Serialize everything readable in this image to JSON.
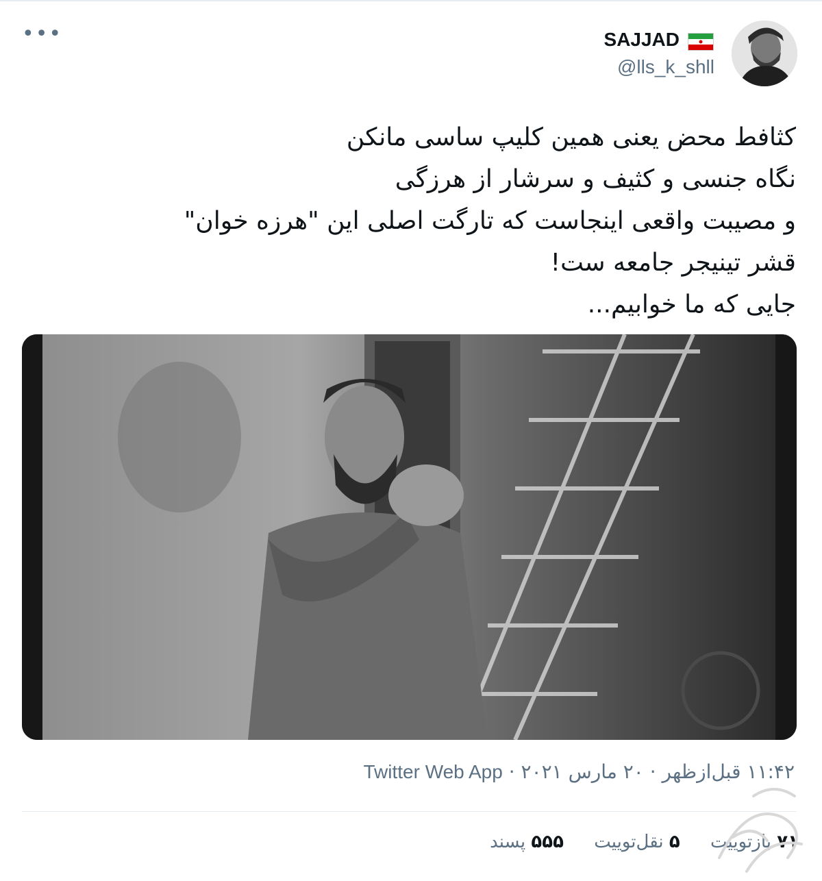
{
  "author": {
    "display_name": "SAJJAD",
    "handle": "@lls_k_shll",
    "flag": "iran-flag-icon"
  },
  "more_label": "•••",
  "tweet": {
    "lines": [
      "کثافط محض یعنی همین کلیپ ساسی مانکن",
      "نگاه جنسی و کثیف و سرشار از هرزگی",
      "و مصیبت واقعی اینجاست که تارگت اصلی این \"هرزه خوان\"",
      "قشر تینیجر جامعه ست!",
      "جایی که ما خوابیم..."
    ]
  },
  "media": {
    "type": "video-thumbnail",
    "description_icon": "video-frame"
  },
  "meta": {
    "time": "۱۱:۴۲ قبل‌ازظهر",
    "date": "۲۰ مارس ۲۰۲۱",
    "separator": "·",
    "source": "Twitter Web App"
  },
  "stats": {
    "retweets_count": "۷۱",
    "retweets_label": "بازتوییت",
    "quotes_count": "۵",
    "quotes_label": "نقل‌توییت",
    "likes_count": "۵۵۵",
    "likes_label": "پسند"
  },
  "colors": {
    "text_primary": "#0f1419",
    "text_secondary": "#5b7083",
    "divider": "#e6ecf0"
  }
}
